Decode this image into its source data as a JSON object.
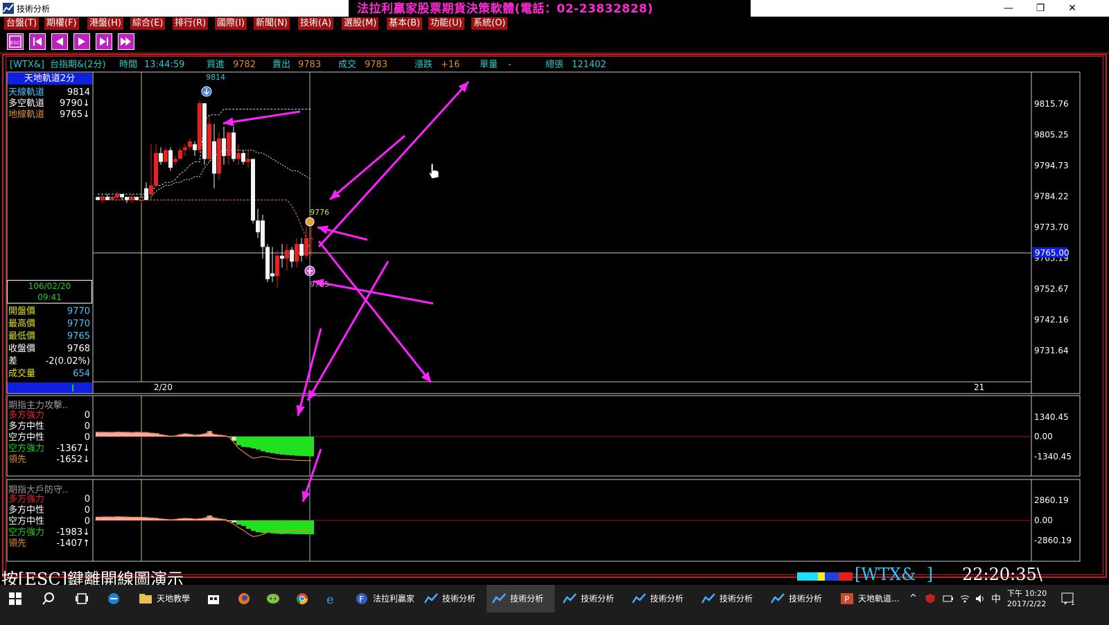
{
  "window": {
    "app_title": "技術分析",
    "banner": "法拉利贏家股票期貨決策軟體(電話：02-23832828)",
    "buttons": [
      "—",
      "❐",
      "✕"
    ]
  },
  "menu": [
    "台盤(T)",
    "期權(F)",
    "港盤(H)",
    "綜合(E)",
    "排行(R)",
    "國際(I)",
    "新聞(N)",
    "技術(A)",
    "選股(M)",
    "基本(B)",
    "功能(U)",
    "系統(O)"
  ],
  "toolbar_icons": [
    "esc-icon",
    "first-icon",
    "prev-icon",
    "next-icon",
    "last-icon",
    "end-icon"
  ],
  "quote": {
    "symbol": "[WTX&]",
    "name": "台指期&(2分)",
    "time_label": "時間",
    "time": "13:44:59",
    "bid_label": "買進",
    "bid": "9782",
    "ask_label": "賣出",
    "ask": "9783",
    "trade_label": "成交",
    "trade": "9783",
    "change_label": "漲跌",
    "change": "+16",
    "volume_label": "單量",
    "volume": "-",
    "total_label": "總張",
    "total": "121402"
  },
  "left_panel": {
    "title": "天地軌道2分",
    "rows": [
      {
        "label": "天線軌道",
        "value": "9814"
      },
      {
        "label": "多空軌道",
        "value": "9790↓"
      },
      {
        "label": "地線軌道",
        "value": "9765↓"
      }
    ],
    "date": "106/02/20",
    "time": "09:41",
    "ohlc": [
      {
        "label": "開盤價",
        "value": "9770"
      },
      {
        "label": "最高價",
        "value": "9770"
      },
      {
        "label": "最低價",
        "value": "9765"
      },
      {
        "label": "收盤價",
        "value": "9768"
      },
      {
        "label": "差",
        "value": "-2(0.02%)"
      },
      {
        "label": "成交量",
        "value": "654"
      }
    ]
  },
  "main_chart": {
    "marker_high": "9814",
    "marker_mid": "9776",
    "marker_low": "9765",
    "current_price": "9765.00",
    "x_ticks": [
      "2/20",
      "21"
    ]
  },
  "sub1": {
    "title": "期指主力攻擊..",
    "rows": [
      {
        "label": "多方強力",
        "value": "0"
      },
      {
        "label": "多方中性",
        "value": "0"
      },
      {
        "label": "空方中性",
        "value": "0"
      },
      {
        "label": "空方強力",
        "value": "-1367↓"
      },
      {
        "label": "領先",
        "value": "-1652↓"
      }
    ],
    "y_ticks": [
      "1340.45",
      "0.00",
      "-1340.45"
    ]
  },
  "sub2": {
    "title": "期指大戶防守..",
    "rows": [
      {
        "label": "多方強力",
        "value": "0"
      },
      {
        "label": "多方中性",
        "value": "0"
      },
      {
        "label": "空方中性",
        "value": "0"
      },
      {
        "label": "空方強力",
        "value": "-1983↓"
      },
      {
        "label": "領先",
        "value": "-1407↑"
      }
    ],
    "y_ticks": [
      "2860.19",
      "0.00",
      "-2860.19"
    ]
  },
  "status": {
    "message": "按[ESC]鍵離開線圖演示",
    "symbol_box": "[WTX&  ]",
    "clock": "22:20:35\\"
  },
  "taskbar": {
    "items": [
      {
        "label": "天地教學",
        "active": false
      },
      {
        "label": "法拉利贏家",
        "active": false
      },
      {
        "label": "技術分析",
        "active": false
      },
      {
        "label": "技術分析",
        "active": true
      },
      {
        "label": "技術分析",
        "active": false
      },
      {
        "label": "技術分析",
        "active": false
      },
      {
        "label": "技術分析",
        "active": false
      },
      {
        "label": "技術分析",
        "active": false
      },
      {
        "label": "天地軌道...",
        "active": false
      }
    ],
    "ime": "中",
    "time": "下午 10:20",
    "date": "2017/2/22",
    "notifications": "1"
  },
  "chart_data": [
    {
      "type": "candlestick",
      "title": "天地軌道2分",
      "ylim": [
        9725,
        9825
      ],
      "y_ticks": [
        9815.76,
        9805.25,
        9794.73,
        9784.22,
        9773.7,
        9763.19,
        9752.67,
        9742.16,
        9731.64
      ],
      "candles": [
        [
          9784,
          9784,
          9783,
          9783
        ],
        [
          9783,
          9785,
          9782,
          9784
        ],
        [
          9784,
          9785,
          9783,
          9783
        ],
        [
          9783,
          9784,
          9783,
          9784
        ],
        [
          9784,
          9786,
          9783,
          9785
        ],
        [
          9785,
          9785,
          9783,
          9784
        ],
        [
          9784,
          9784,
          9782,
          9783
        ],
        [
          9783,
          9785,
          9782,
          9784
        ],
        [
          9784,
          9784,
          9783,
          9783
        ],
        [
          9783,
          9784,
          9782,
          9783
        ],
        [
          9787,
          9789,
          9783,
          9783
        ],
        [
          9785,
          9802,
          9783,
          9788
        ],
        [
          9788,
          9802,
          9790,
          9799
        ],
        [
          9799,
          9801,
          9795,
          9796
        ],
        [
          9796,
          9801,
          9796,
          9800
        ],
        [
          9800,
          9801,
          9793,
          9794
        ],
        [
          9796,
          9798,
          9795,
          9797
        ],
        [
          9797,
          9801,
          9797,
          9800
        ],
        [
          9800,
          9802,
          9798,
          9801
        ],
        [
          9801,
          9804,
          9800,
          9803
        ],
        [
          9802,
          9803,
          9798,
          9800
        ],
        [
          9800,
          9817,
          9799,
          9816
        ],
        [
          9816,
          9816,
          9795,
          9797
        ],
        [
          9797,
          9812,
          9796,
          9809
        ],
        [
          9803,
          9809,
          9787,
          9792
        ],
        [
          9792,
          9806,
          9790,
          9804
        ],
        [
          9804,
          9808,
          9795,
          9798
        ],
        [
          9798,
          9806,
          9795,
          9806
        ],
        [
          9806,
          9808,
          9796,
          9797
        ],
        [
          9797,
          9802,
          9795,
          9799
        ],
        [
          9799,
          9800,
          9795,
          9796
        ],
        [
          9796,
          9800,
          9794,
          9797
        ],
        [
          9797,
          9797,
          9775,
          9776
        ],
        [
          9776,
          9780,
          9770,
          9772
        ],
        [
          9776,
          9778,
          9763,
          9767
        ],
        [
          9767,
          9768,
          9755,
          9756
        ],
        [
          9758,
          9767,
          9755,
          9757
        ],
        [
          9757,
          9766,
          9753,
          9764
        ],
        [
          9764,
          9768,
          9760,
          9763
        ],
        [
          9763,
          9768,
          9759,
          9766
        ],
        [
          9766,
          9767,
          9760,
          9762
        ],
        [
          9762,
          9770,
          9760,
          9768
        ],
        [
          9768,
          9770,
          9762,
          9764
        ],
        [
          9764,
          9774,
          9763,
          9770
        ],
        [
          9770,
          9776,
          9764,
          9770
        ]
      ],
      "upper_band": [
        9785,
        9785,
        9785,
        9785,
        9785,
        9785,
        9785,
        9785,
        9785,
        9785,
        9785,
        9785,
        9788,
        9788,
        9789,
        9789,
        9790,
        9792,
        9793,
        9795,
        9796,
        9796,
        9810,
        9812,
        9812,
        9812,
        9814,
        9814,
        9814,
        9814,
        9814,
        9814,
        9814,
        9814,
        9814,
        9814,
        9814,
        9814,
        9814,
        9814,
        9814,
        9814,
        9814,
        9814,
        9814
      ],
      "mid_band": [
        9784,
        9784,
        9784,
        9784,
        9784,
        9784,
        9784,
        9784,
        9784,
        9784,
        9784,
        9784,
        9786,
        9787,
        9788,
        9788,
        9789,
        9789,
        9790,
        9790,
        9791,
        9791,
        9794,
        9796,
        9798,
        9799,
        9800,
        9800,
        9800,
        9800,
        9800,
        9800,
        9800,
        9799,
        9799,
        9798,
        9797,
        9796,
        9795,
        9794,
        9793,
        9793,
        9792,
        9791,
        9790
      ],
      "lower_band": [
        9783,
        9783,
        9783,
        9783,
        9783,
        9783,
        9783,
        9783,
        9783,
        9783,
        9783,
        9783,
        9783,
        9783,
        9783,
        9783,
        9783,
        9783,
        9783,
        9783,
        9783,
        9783,
        9783,
        9783,
        9783,
        9783,
        9783,
        9783,
        9783,
        9783,
        9783,
        9783,
        9783,
        9783,
        9783,
        9783,
        9783,
        9783,
        9783,
        9783,
        9781,
        9778,
        9774,
        9770,
        9765
      ],
      "x_labels": [
        "2/20",
        "21"
      ]
    },
    {
      "type": "bar",
      "title": "期指主力攻擊..",
      "ylim": [
        -1340.45,
        1340.45
      ],
      "values": [
        320,
        320,
        300,
        310,
        330,
        320,
        320,
        300,
        320,
        310,
        300,
        260,
        230,
        150,
        90,
        30,
        60,
        150,
        210,
        170,
        100,
        140,
        200,
        380,
        160,
        120,
        80,
        0,
        -300,
        -600,
        -720,
        -750,
        -820,
        -900,
        -1020,
        -1100,
        -1150,
        -1200,
        -1250,
        -1280,
        -1300,
        -1330,
        -1350,
        -1360,
        -1367
      ],
      "lead_line": [
        280,
        290,
        290,
        280,
        300,
        290,
        280,
        270,
        290,
        280,
        270,
        230,
        200,
        130,
        70,
        20,
        50,
        130,
        190,
        150,
        90,
        120,
        180,
        330,
        140,
        100,
        60,
        -20,
        -380,
        -800,
        -1050,
        -1300,
        -1500,
        -1450,
        -1380,
        -1420,
        -1500,
        -1550,
        -1600,
        -1580,
        -1620,
        -1640,
        -1650,
        -1660,
        -1652
      ]
    },
    {
      "type": "bar",
      "title": "期指大戶防守..",
      "ylim": [
        -2860.19,
        2860.19
      ],
      "values": [
        500,
        520,
        540,
        520,
        560,
        540,
        520,
        500,
        500,
        480,
        450,
        380,
        350,
        250,
        180,
        120,
        160,
        280,
        320,
        300,
        220,
        260,
        350,
        700,
        380,
        260,
        160,
        -100,
        -300,
        -600,
        -800,
        -1200,
        -1500,
        -1700,
        -1800,
        -1750,
        -1850,
        -1900,
        -1950,
        -1920,
        -1940,
        -1960,
        -1970,
        -1980,
        -1983
      ],
      "lead_line": [
        450,
        480,
        500,
        470,
        510,
        490,
        470,
        450,
        450,
        430,
        400,
        340,
        300,
        210,
        150,
        90,
        130,
        240,
        290,
        260,
        180,
        230,
        310,
        620,
        340,
        220,
        120,
        -180,
        -500,
        -1000,
        -1400,
        -1900,
        -2300,
        -2200,
        -2000,
        -1700,
        -1500,
        -1600,
        -1550,
        -1450,
        -1420,
        -1410,
        -1400,
        -1405,
        -1407
      ]
    }
  ]
}
